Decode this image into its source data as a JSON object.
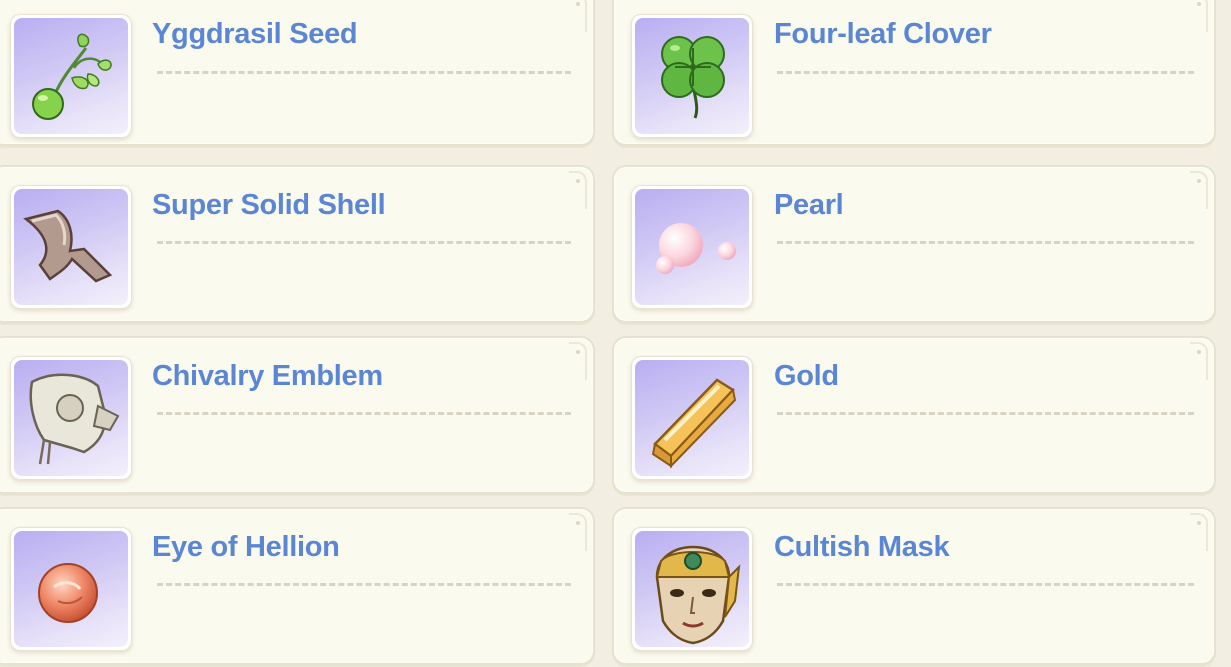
{
  "items": [
    {
      "name": "Yggdrasil Seed",
      "icon": "yggdrasil-seed-icon"
    },
    {
      "name": "Four-leaf Clover",
      "icon": "four-leaf-clover-icon"
    },
    {
      "name": "Super Solid Shell",
      "icon": "super-solid-shell-icon"
    },
    {
      "name": "Pearl",
      "icon": "pearl-icon"
    },
    {
      "name": "Chivalry Emblem",
      "icon": "chivalry-emblem-icon"
    },
    {
      "name": "Gold",
      "icon": "gold-icon"
    },
    {
      "name": "Eye of Hellion",
      "icon": "eye-of-hellion-icon"
    },
    {
      "name": "Cultish Mask",
      "icon": "cultish-mask-icon"
    }
  ],
  "colors": {
    "name_text": "#5b86d4",
    "card_bg": "#fbfaee",
    "icon_bg_top": "#b9aef2",
    "icon_bg_bottom": "#f3f0fb"
  }
}
